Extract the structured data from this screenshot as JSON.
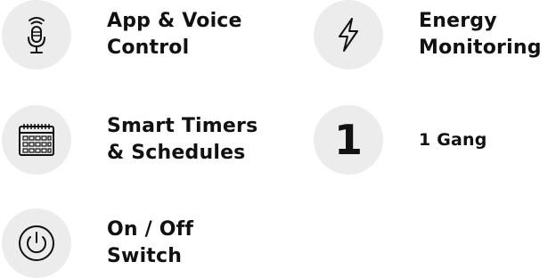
{
  "features": {
    "app_voice": {
      "icon": "microphone-icon",
      "line1": "App & Voice",
      "line2": "Control"
    },
    "timers": {
      "icon": "calendar-icon",
      "line1": "Smart Timers",
      "line2": "& Schedules"
    },
    "switch": {
      "icon": "power-icon",
      "line1": "On / Off",
      "line2": "Switch"
    },
    "energy": {
      "icon": "lightning-icon",
      "line1": "Energy",
      "line2": "Monitoring"
    },
    "gang": {
      "icon_text": "1",
      "line1": "1 Gang"
    }
  },
  "colors": {
    "icon_background": "#ececec",
    "text": "#111111"
  }
}
